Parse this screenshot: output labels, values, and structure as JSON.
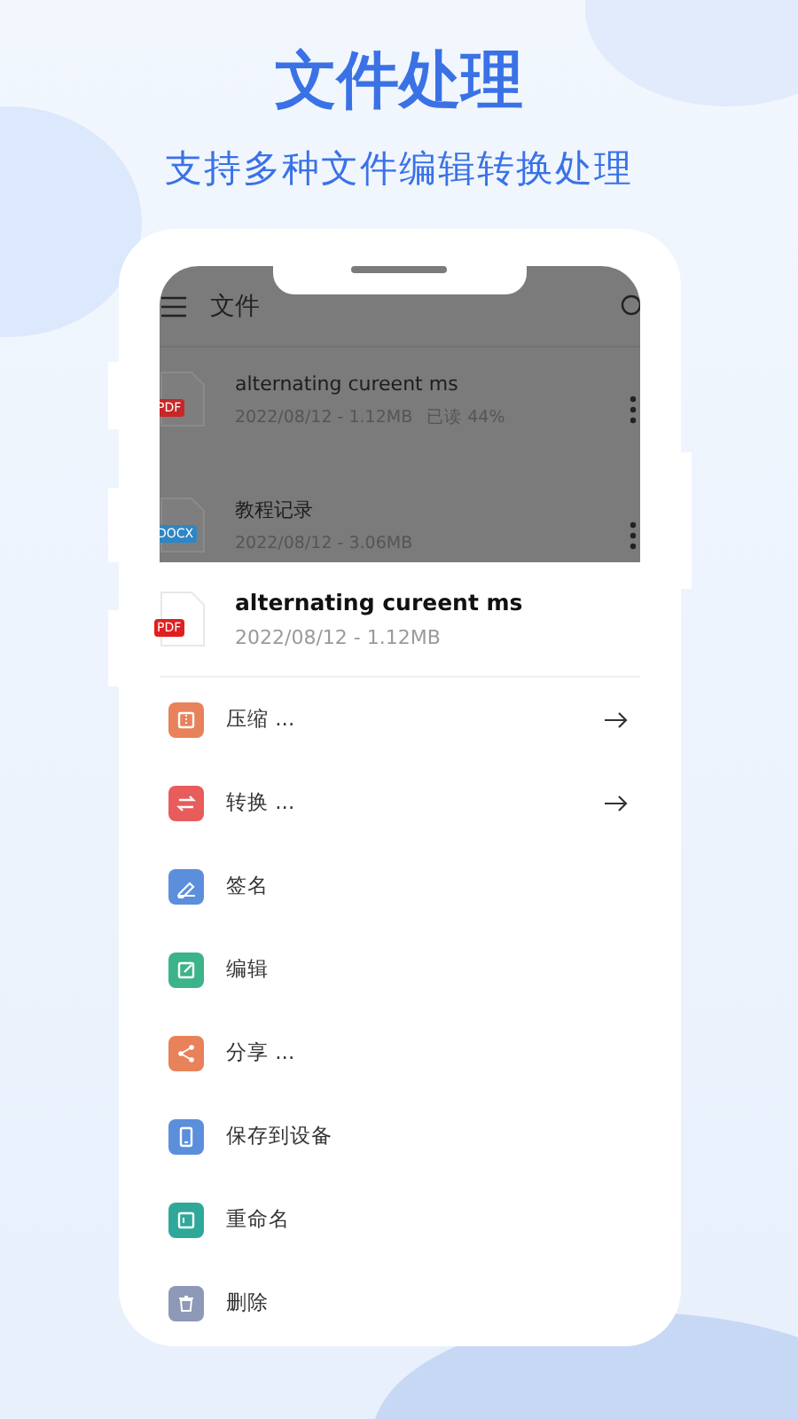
{
  "headline": "文件处理",
  "subheadline": "支持多种文件编辑转换处理",
  "app_bar": {
    "title": "文件"
  },
  "files": [
    {
      "name": "alternating cureent ms",
      "meta": "2022/08/12 - 1.12MB",
      "read_note": "已读 44%",
      "badge": "PDF",
      "color": "#c62828"
    },
    {
      "name": "教程记录",
      "meta": "2022/08/12 - 3.06MB",
      "badge": "DOCX",
      "color": "#2f86c4"
    }
  ],
  "sheet": {
    "file": {
      "name": "alternating cureent ms",
      "meta": "2022/08/12 - 1.12MB",
      "badge": "PDF",
      "color": "#e02020"
    },
    "actions": [
      {
        "label": "压缩 ...",
        "kind": "compress",
        "color": "#e8825a",
        "has_arrow": true
      },
      {
        "label": "转换 ...",
        "kind": "convert",
        "color": "#e85c5c",
        "has_arrow": true
      },
      {
        "label": "签名",
        "kind": "sign",
        "color": "#5b8fdc",
        "has_arrow": false
      },
      {
        "label": "编辑",
        "kind": "edit",
        "color": "#3cb388",
        "has_arrow": false
      },
      {
        "label": "分享 ...",
        "kind": "share",
        "color": "#e8825a",
        "has_arrow": false
      },
      {
        "label": "保存到设备",
        "kind": "save",
        "color": "#5b8fdc",
        "has_arrow": false
      },
      {
        "label": "重命名",
        "kind": "rename",
        "color": "#2fa89a",
        "has_arrow": false
      },
      {
        "label": "删除",
        "kind": "delete",
        "color": "#8e99b8",
        "has_arrow": false
      }
    ]
  }
}
